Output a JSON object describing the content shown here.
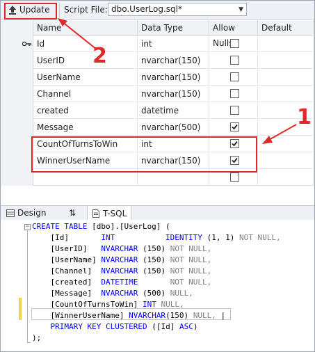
{
  "toolbar": {
    "update_label": "Update",
    "script_file_label": "Script File:",
    "script_file_value": "dbo.UserLog.sql*"
  },
  "grid": {
    "headers": [
      "Name",
      "Data Type",
      "Allow Nulls",
      "Default"
    ],
    "rows": [
      {
        "name": "Id",
        "type": "int",
        "allow_nulls": false,
        "primary_key": true
      },
      {
        "name": "UserID",
        "type": "nvarchar(150)",
        "allow_nulls": false
      },
      {
        "name": "UserName",
        "type": "nvarchar(150)",
        "allow_nulls": false
      },
      {
        "name": "Channel",
        "type": "nvarchar(150)",
        "allow_nulls": false
      },
      {
        "name": "created",
        "type": "datetime",
        "allow_nulls": false
      },
      {
        "name": "Message",
        "type": "nvarchar(500)",
        "allow_nulls": true
      },
      {
        "name": "CountOfTurnsToWin",
        "type": "int",
        "allow_nulls": true
      },
      {
        "name": "WinnerUserName",
        "type": "nvarchar(150)",
        "allow_nulls": true
      },
      {
        "name": "",
        "type": "",
        "allow_nulls": false
      }
    ]
  },
  "annotations": {
    "label_1": "1",
    "label_2": "2",
    "color": "#e02a2a"
  },
  "tabs": {
    "design": "Design",
    "swap": "⇅",
    "tsql": "T-SQL"
  },
  "sql": {
    "lines": [
      "CREATE TABLE [dbo].[UserLog] (",
      "    [Id]       INT           IDENTITY (1, 1) NOT NULL,",
      "    [UserID]   NVARCHAR (150) NOT NULL,",
      "    [UserName] NVARCHAR (150) NOT NULL,",
      "    [Channel]  NVARCHAR (150) NOT NULL,",
      "    [created]  DATETIME       NOT NULL,",
      "    [Message]  NVARCHAR (500) NULL,",
      "    [CountOfTurnsToWin] INT NULL,",
      "    [WinnerUserName] NVARCHAR(150) NULL,",
      "    PRIMARY KEY CLUSTERED ([Id] ASC)",
      ");"
    ]
  }
}
